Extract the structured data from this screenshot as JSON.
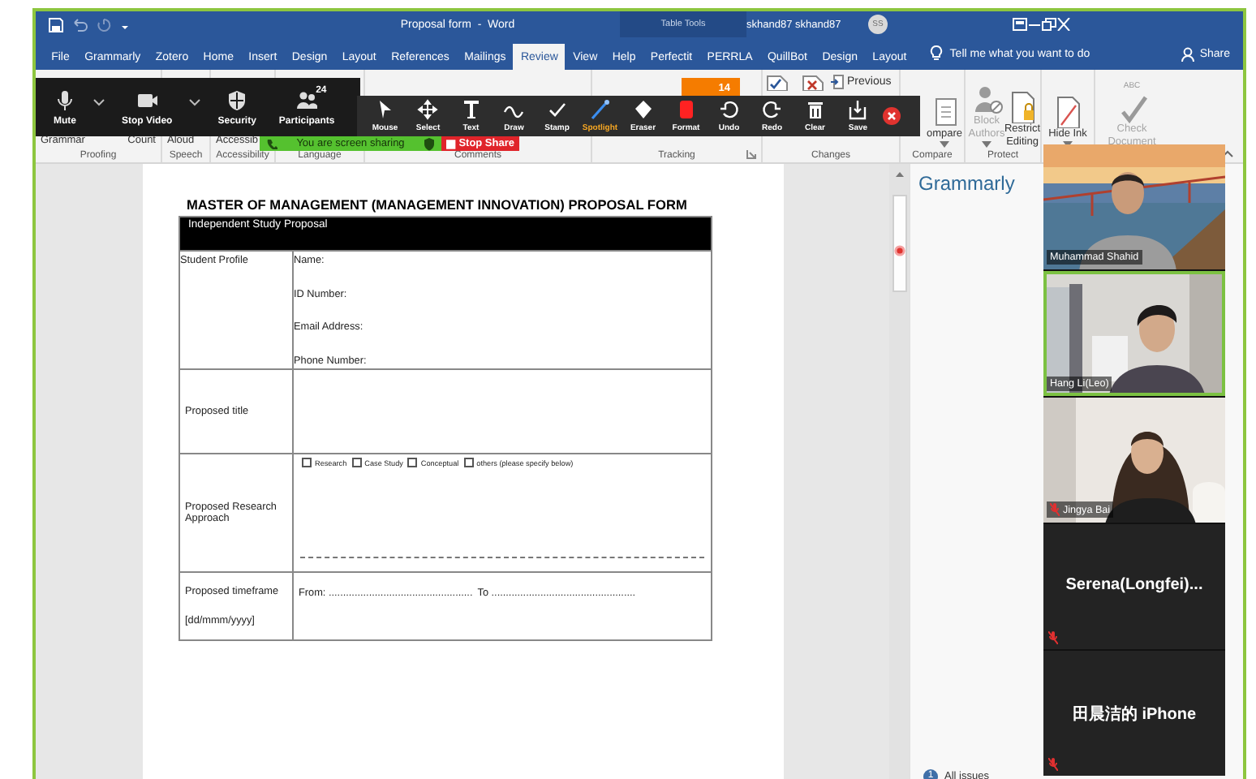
{
  "title_bar": {
    "title": "Proposal form  -  Word",
    "context_label": "Table Tools",
    "user": "skhand87 skhand87",
    "avatar": "SS"
  },
  "ribbon_tabs": [
    {
      "label": "File",
      "selected": false
    },
    {
      "label": "Grammarly",
      "selected": false
    },
    {
      "label": "Zotero",
      "selected": false
    },
    {
      "label": "Home",
      "selected": false
    },
    {
      "label": "Insert",
      "selected": false
    },
    {
      "label": "Design",
      "selected": false
    },
    {
      "label": "Layout",
      "selected": false
    },
    {
      "label": "References",
      "selected": false
    },
    {
      "label": "Mailings",
      "selected": false
    },
    {
      "label": "Review",
      "selected": true
    },
    {
      "label": "View",
      "selected": false
    },
    {
      "label": "Help",
      "selected": false
    },
    {
      "label": "Perfectit",
      "selected": false
    },
    {
      "label": "PERRLA",
      "selected": false
    },
    {
      "label": "QuillBot",
      "selected": false
    },
    {
      "label": "Design",
      "selected": false
    },
    {
      "label": "Layout",
      "selected": false
    }
  ],
  "tell_me": {
    "placeholder": "Tell me what you want to do"
  },
  "share": "Share",
  "ribbon_groups": [
    {
      "label": "Proofing",
      "buttons": [
        {
          "label": "Grammar",
          "kind": "text"
        },
        {
          "label": "Count",
          "kind": "text"
        }
      ]
    },
    {
      "label": "Speech",
      "buttons": [
        {
          "label": "Aloud",
          "kind": "text"
        }
      ]
    },
    {
      "label": "Accessibility",
      "buttons": [
        {
          "label": "Accessib",
          "kind": "text"
        }
      ]
    },
    {
      "label": "Language"
    },
    {
      "label": "Comments"
    },
    {
      "label": "Tracking",
      "launcher": true
    },
    {
      "label": "Changes",
      "buttons": [
        {
          "label": "Previous",
          "kind": "small"
        }
      ]
    },
    {
      "label": "Compare",
      "buttons": [
        {
          "label": "ompare",
          "kind": "large",
          "dropdown": true,
          "disabled": false
        }
      ]
    },
    {
      "label": "Protect",
      "buttons": [
        {
          "label": "Block Authors",
          "kind": "large",
          "dropdown": true,
          "disabled": true
        },
        {
          "label": "Restrict Editing",
          "kind": "large",
          "dropdown": false,
          "disabled": false
        }
      ]
    },
    {
      "buttons": [
        {
          "label": "Hide Ink",
          "kind": "large",
          "dropdown": true,
          "disabled": false
        }
      ]
    },
    {
      "buttons": [
        {
          "label": "Check Document",
          "kind": "large",
          "dropdown": false,
          "disabled": true,
          "icon_text": "ABC"
        }
      ]
    }
  ],
  "meeting_controls": [
    {
      "label": "Mute",
      "menu": true
    },
    {
      "label": "Stop Video",
      "menu": true
    },
    {
      "label": "Security",
      "menu": false
    },
    {
      "label": "Participants",
      "menu": false,
      "count": "24"
    }
  ],
  "annotation_tools": [
    {
      "label": "Mouse",
      "selected": false
    },
    {
      "label": "Select",
      "selected": false
    },
    {
      "label": "Text",
      "selected": false
    },
    {
      "label": "Draw",
      "selected": false
    },
    {
      "label": "Stamp",
      "selected": false
    },
    {
      "label": "Spotlight",
      "selected": true
    },
    {
      "label": "Eraser",
      "selected": false
    },
    {
      "label": "Format",
      "selected": false
    },
    {
      "label": "Undo",
      "selected": false
    },
    {
      "label": "Redo",
      "selected": false
    },
    {
      "label": "Clear",
      "selected": false
    },
    {
      "label": "Save",
      "selected": false
    }
  ],
  "view_counter": "14",
  "share_banner": {
    "text": "You are screen sharing",
    "stop_label": "Stop Share"
  },
  "document": {
    "heading": "MASTER OF MANAGEMENT (MANAGEMENT INNOVATION) PROPOSAL FORM",
    "table": {
      "header": "Independent Study Proposal",
      "rows": [
        {
          "kind": "fields",
          "label": "Student Profile",
          "lines": [
            "Name:",
            "ID Number:",
            "Email Address:",
            "Phone Number:"
          ]
        },
        {
          "kind": "blank",
          "label": "Proposed title"
        },
        {
          "kind": "options",
          "label": "Proposed Research Approach",
          "options": [
            {
              "label": "Research",
              "checked": false
            },
            {
              "label": "Case Study",
              "checked": false
            },
            {
              "label": "Conceptual",
              "checked": false
            },
            {
              "label": "others (please specify below)",
              "checked": false
            }
          ]
        },
        {
          "kind": "range",
          "label": "Proposed timeframe",
          "note": "[dd/mmm/yyyy]",
          "from": "From: ..................................................",
          "to": "To .................................................."
        }
      ]
    }
  },
  "grammarly": {
    "title": "Grammarly",
    "issues_count": "1",
    "issues_label": "All issues"
  },
  "participants": [
    {
      "name": "Muhammad Shahid",
      "kind": "video",
      "muted": false,
      "active": false
    },
    {
      "name": "Hang Li(Leo)",
      "kind": "video",
      "muted": false,
      "active": true
    },
    {
      "name": "Jingya Bai",
      "kind": "video",
      "muted": true,
      "active": false
    },
    {
      "name": "Serena(Longfei)...",
      "kind": "name_only",
      "muted": true,
      "active": false
    },
    {
      "name": "田晨洁的 iPhone",
      "kind": "name_only",
      "muted": true,
      "active": false
    }
  ]
}
